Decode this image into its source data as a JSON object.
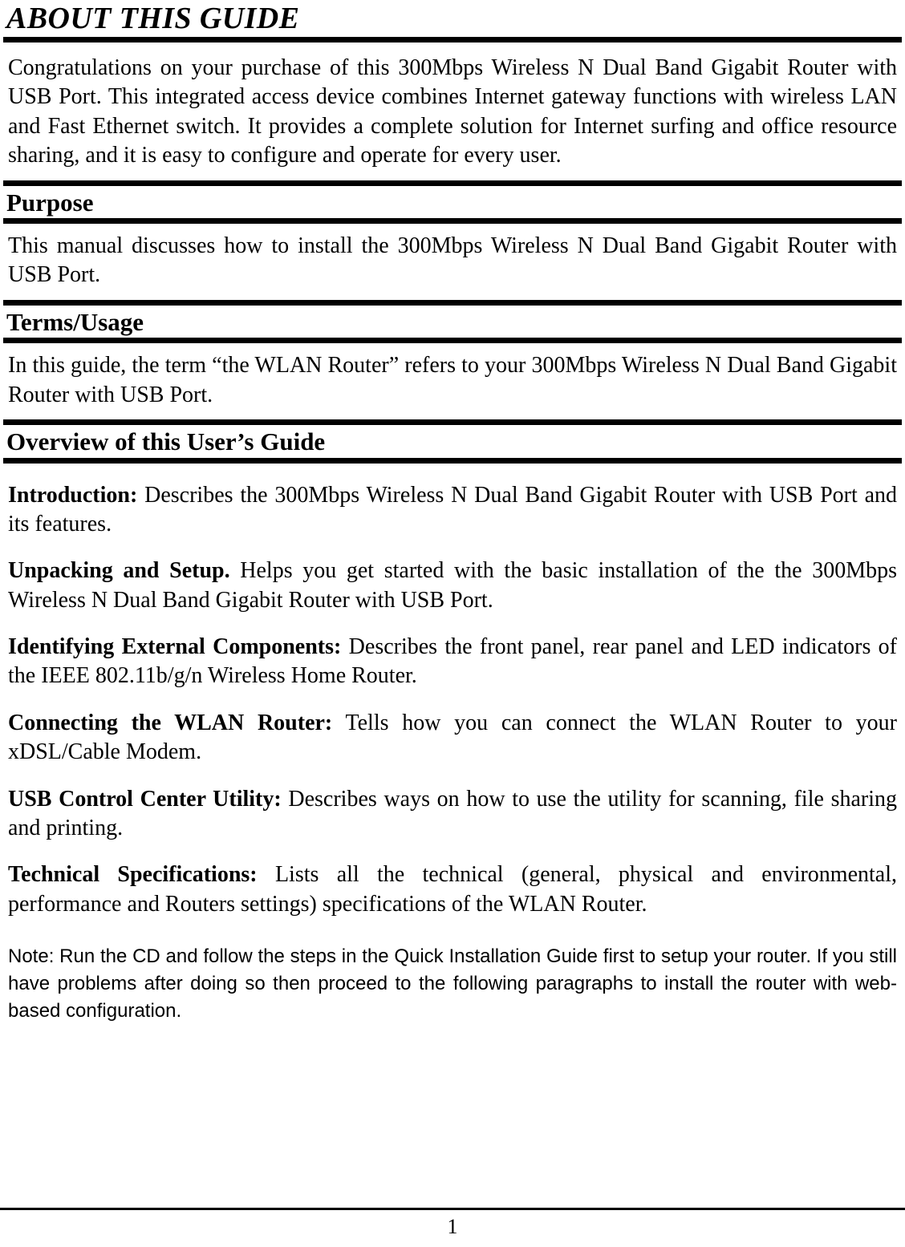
{
  "document": {
    "title": "ABOUT THIS GUIDE",
    "intro_paragraph": "Congratulations on your purchase of this 300Mbps Wireless N Dual Band Gigabit Router with USB Port. This integrated access device combines Internet gateway functions with wireless LAN and Fast Ethernet switch. It provides a complete solution for Internet surfing and office resource sharing, and it is easy to configure and operate for every user."
  },
  "sections": [
    {
      "heading": "Purpose",
      "body": "This manual discusses how to install the 300Mbps Wireless N Dual Band Gigabit Router with USB Port."
    },
    {
      "heading": "Terms/Usage",
      "body": "In this guide, the term “the WLAN Router” refers to your 300Mbps Wireless N Dual Band Gigabit Router with USB Port."
    },
    {
      "heading": "Overview of this User’s Guide"
    }
  ],
  "overview_items": [
    {
      "term": "Introduction:",
      "description": "  Describes the 300Mbps Wireless N Dual Band Gigabit Router with USB Port and its features."
    },
    {
      "term": "Unpacking and Setup.",
      "description": " Helps you get started with the basic installation of the the 300Mbps Wireless N Dual Band Gigabit Router with USB Port."
    },
    {
      "term": "Identifying External Components:",
      "description": "  Describes the front panel, rear panel and LED indicators of the IEEE 802.11b/g/n Wireless Home Router."
    },
    {
      "term": "Connecting the WLAN Router:",
      "description": " Tells how you can connect the WLAN Router to your xDSL/Cable Modem."
    },
    {
      "term": "USB Control Center Utility:",
      "description": " Describes ways on how to use the utility for scanning, file sharing and printing."
    },
    {
      "term": "Technical Specifications:",
      "description": " Lists all the technical (general, physical and environmental, performance and Routers settings) specifications of the WLAN Router."
    }
  ],
  "note": "Note: Run the CD and follow the steps in the Quick Installation Guide first to setup your router. If you still have problems after doing so then proceed to the following paragraphs to install the router with web-based configuration.",
  "footer": {
    "page_number": "1"
  }
}
